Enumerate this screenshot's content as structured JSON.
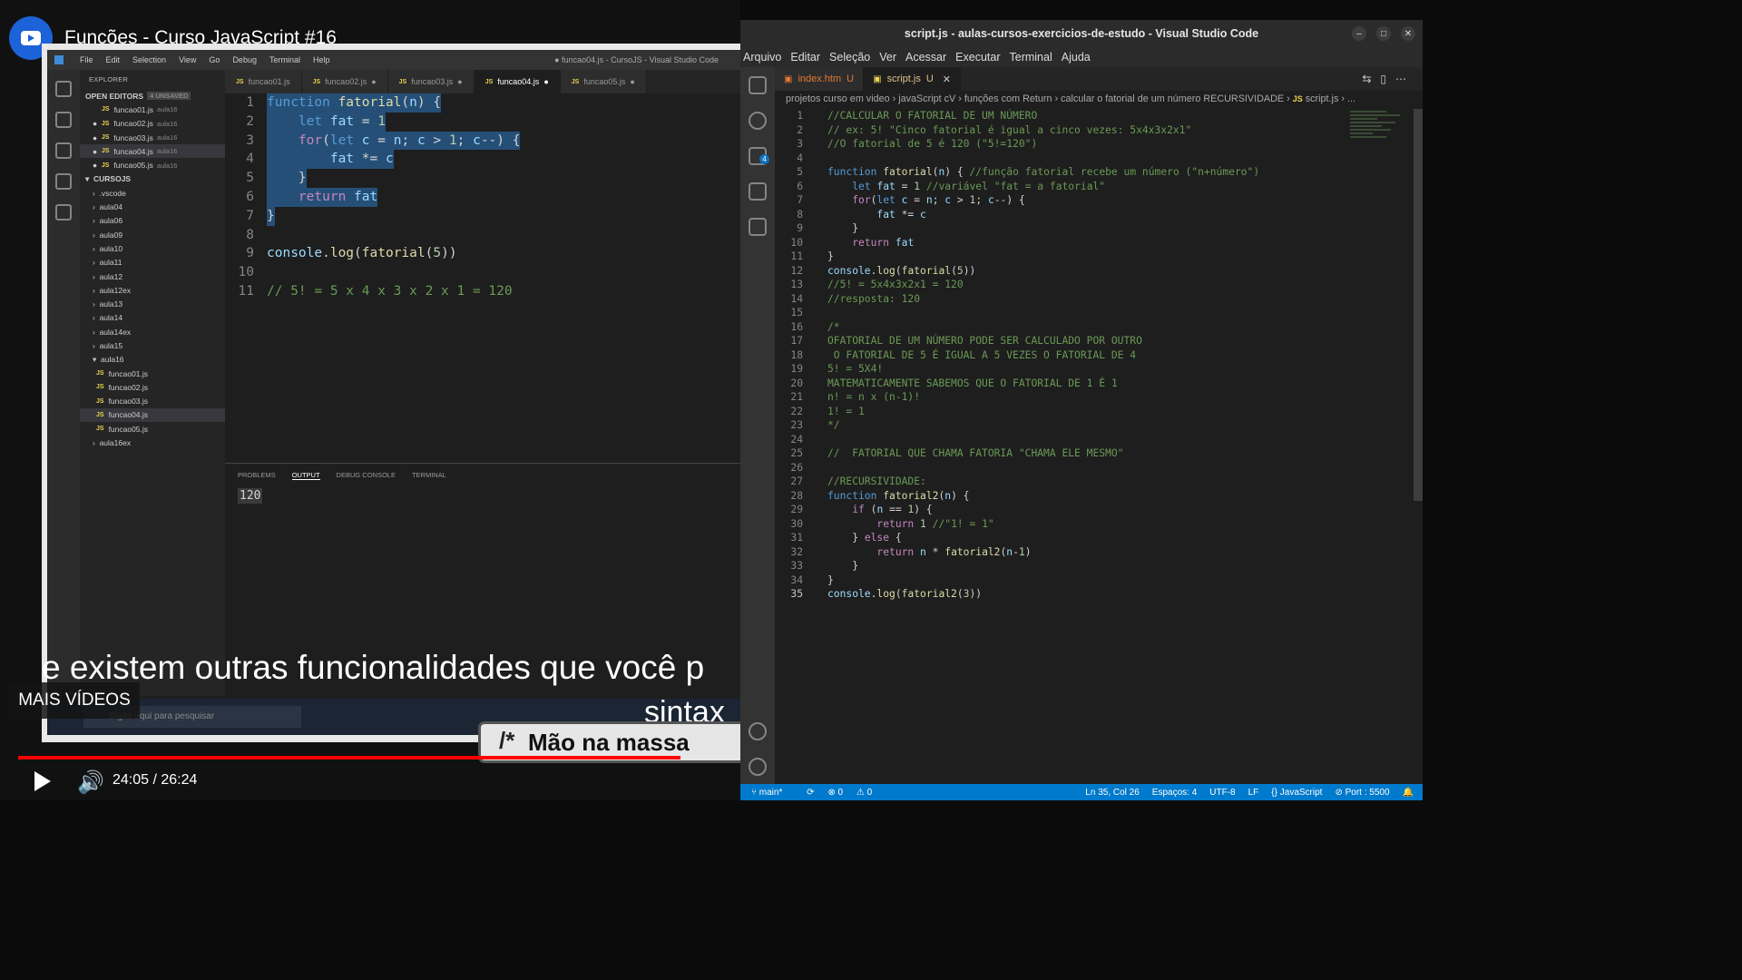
{
  "video": {
    "title": "Funções - Curso JavaScript #16",
    "subtitle_line1": "e existem outras funcionalidades que você p",
    "subtitle_line2": "sintax",
    "lower_third": "Mão na massa",
    "lower_third_slash": "/*",
    "more_videos": "MAIS VÍDEOS",
    "time": "24:05 / 26:24",
    "progress_fraction": 0.917,
    "accent_color": "#ff0000"
  },
  "inner_ide": {
    "menu": [
      "File",
      "Edit",
      "Selection",
      "View",
      "Go",
      "Debug",
      "Terminal",
      "Help"
    ],
    "window_title": "● funcao04.js - CursoJS - Visual Studio Code",
    "explorer_header": "EXPLORER",
    "open_editors_header": "OPEN EDITORS",
    "unsaved": "4 UNSAVED",
    "open_editors": [
      {
        "name": "funcao01.js",
        "dir": "aula16"
      },
      {
        "name": "funcao02.js",
        "dir": "aula16"
      },
      {
        "name": "funcao03.js",
        "dir": "aula16"
      },
      {
        "name": "funcao04.js",
        "dir": "aula16"
      },
      {
        "name": "funcao05.js",
        "dir": "aula16"
      }
    ],
    "project_header": "CURSOJS",
    "folders": [
      ".vscode",
      "aula04",
      "aula06",
      "aula09",
      "aula10",
      "aula11",
      "aula12",
      "aula12ex",
      "aula13",
      "aula14",
      "aula14ex",
      "aula15",
      "aula16"
    ],
    "aula16_files": [
      "funcao01.js",
      "funcao02.js",
      "funcao03.js",
      "funcao04.js",
      "funcao05.js"
    ],
    "last_folder": "aula16ex",
    "tabs": [
      "funcao01.js",
      "funcao02.js",
      "funcao03.js",
      "funcao04.js",
      "funcao05.js"
    ],
    "active_tab": "funcao04.js",
    "panel_tabs": [
      "PROBLEMS",
      "OUTPUT",
      "DEBUG CONSOLE",
      "TERMINAL"
    ],
    "output": "120",
    "taskbar_search": "Digite aqui para pesquisar"
  },
  "vscode": {
    "window_title": "script.js - aulas-cursos-exercicios-de-estudo - Visual Studio Code",
    "menu": [
      "Arquivo",
      "Editar",
      "Seleção",
      "Ver",
      "Acessar",
      "Executar",
      "Terminal",
      "Ajuda"
    ],
    "scm_badge": "4",
    "tabs": [
      {
        "name": "index.htm",
        "status": "U"
      },
      {
        "name": "script.js",
        "status": "U"
      }
    ],
    "breadcrumb": [
      "projetos curso em video",
      "javaScript cV",
      "funções com Return",
      "calcular o fatorial de um número RECURSIVIDADE",
      "script.js",
      "..."
    ],
    "status": {
      "branch": "main*",
      "errors": "0",
      "warnings": "0",
      "position": "Ln 35, Col 26",
      "spaces": "Espaços: 4",
      "encoding": "UTF-8",
      "eol": "LF",
      "language": "JavaScript",
      "port": "Port : 5500"
    },
    "accent_color": "#007acc"
  }
}
